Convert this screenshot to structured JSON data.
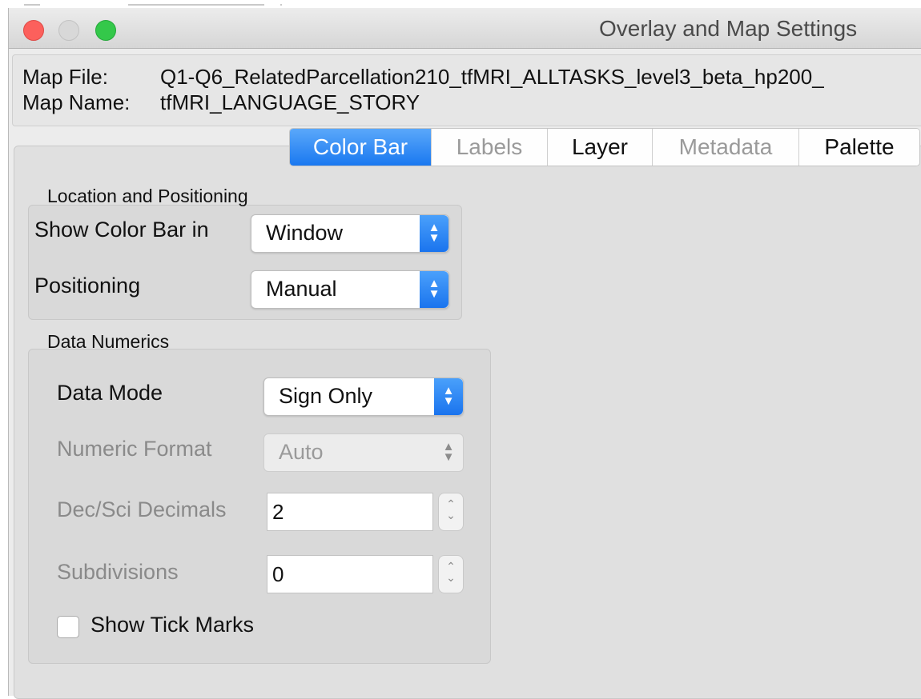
{
  "window": {
    "title": "Overlay and Map Settings"
  },
  "info": {
    "map_file_label": "Map File:",
    "map_file_value": "Q1-Q6_RelatedParcellation210_tfMRI_ALLTASKS_level3_beta_hp200_",
    "map_name_label": "Map Name:",
    "map_name_value": "tfMRI_LANGUAGE_STORY"
  },
  "tabs": [
    {
      "label": "Color Bar",
      "state": "selected"
    },
    {
      "label": "Labels",
      "state": "disabled"
    },
    {
      "label": "Layer",
      "state": "enabled"
    },
    {
      "label": "Metadata",
      "state": "disabled"
    },
    {
      "label": "Palette",
      "state": "enabled"
    }
  ],
  "location": {
    "title": "Location and Positioning",
    "show_label": "Show Color Bar in",
    "show_value": "Window",
    "positioning_label": "Positioning",
    "positioning_value": "Manual"
  },
  "numerics": {
    "title": "Data Numerics",
    "data_mode_label": "Data Mode",
    "data_mode_value": "Sign Only",
    "numeric_format_label": "Numeric Format",
    "numeric_format_value": "Auto",
    "decimals_label": "Dec/Sci Decimals",
    "decimals_value": "2",
    "subdivisions_label": "Subdivisions",
    "subdivisions_value": "0",
    "show_tick_marks_label": "Show Tick Marks",
    "show_tick_marks_checked": false
  },
  "colors": {
    "accent": "#1a78f0",
    "close": "#fc605c",
    "maximize": "#34c84a"
  }
}
